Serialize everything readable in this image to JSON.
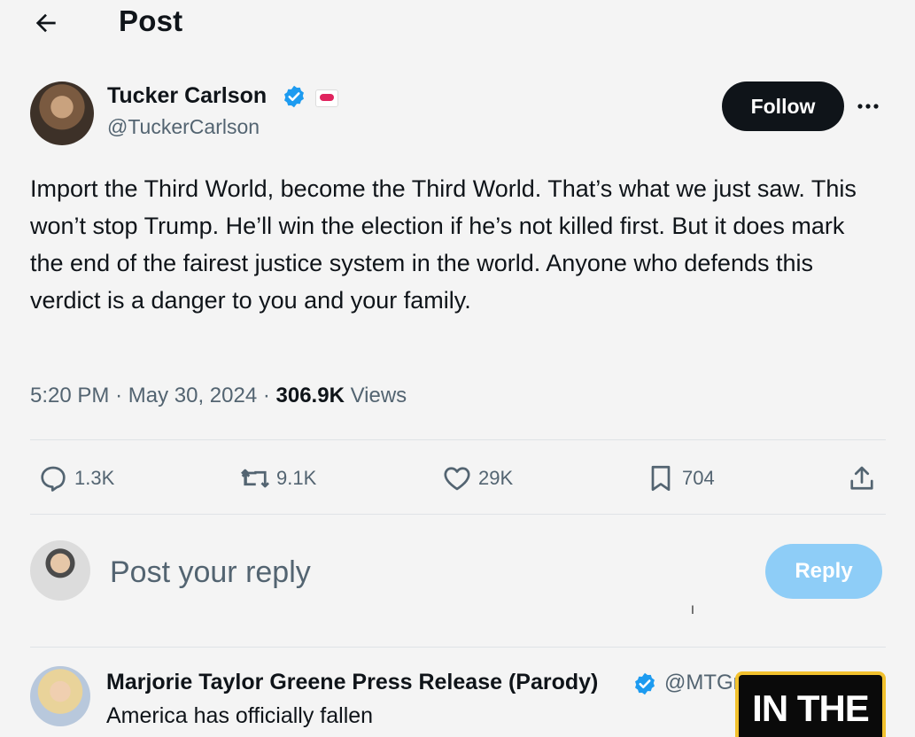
{
  "header": {
    "title": "Post",
    "back_icon": "arrow-left-icon"
  },
  "post": {
    "author_name": "Tucker Carlson",
    "author_handle": "@TuckerCarlson",
    "follow_label": "Follow",
    "more_icon": "more-horizontal-icon",
    "text": "Import the Third World, become the Third World. That’s what we just saw. This won’t stop Trump. He’ll win the election if he’s not killed first. But it does mark the end of the fairest justice system in the world. Anyone who defends this verdict is a danger to you and your family.",
    "time": "5:20 PM",
    "date": "May 30, 2024",
    "views_count": "306.9K",
    "views_label": "Views",
    "separator": "·"
  },
  "actions": {
    "replies": "1.3K",
    "reposts": "9.1K",
    "likes": "29K",
    "bookmarks": "704"
  },
  "compose": {
    "placeholder": "Post your reply",
    "reply_label": "Reply",
    "cursor": "I"
  },
  "reply": {
    "author_name": "Marjorie Taylor Greene Press Release (Parody)",
    "author_handle": "@MTGr",
    "text": "America has officially fallen"
  },
  "overlay": {
    "text": "IN THE"
  },
  "colors": {
    "accent_blue": "#1d9bf0",
    "reply_button_disabled": "#8ecdf7",
    "follow_bg": "#0f1419",
    "secondary_text": "#536471",
    "overlay_border": "#f2c12e"
  }
}
